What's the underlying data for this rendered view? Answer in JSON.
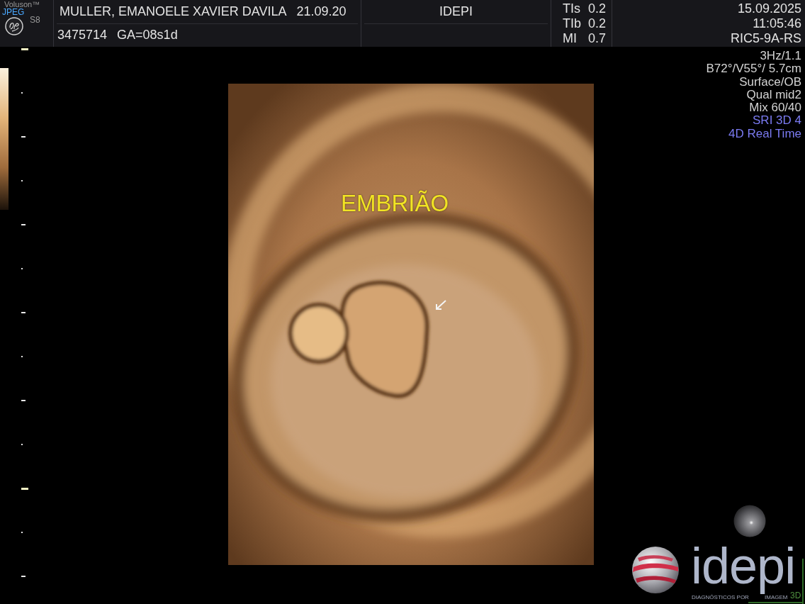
{
  "header": {
    "system": {
      "brand": "Voluson™",
      "format": "JPEG",
      "model": "S8"
    },
    "patient": {
      "name": "MULLER, EMANOELE XAVIER DAVILA",
      "birth_date": "21.09.20",
      "id": "3475714",
      "gestational_age": "GA=08s1d"
    },
    "institution": "IDEPI",
    "indices": [
      {
        "label": "TIs",
        "value": "0.2"
      },
      {
        "label": "TIb",
        "value": "0.2"
      },
      {
        "label": "MI",
        "value": "0.7"
      }
    ],
    "date": "15.09.2025",
    "time": "11:05:46",
    "probe": "RIC5-9A-RS"
  },
  "parameters": [
    {
      "text": "3Hz/1.1",
      "color": "#d4d4d4"
    },
    {
      "text": "B72°/V55°/ 5.7cm",
      "color": "#d4d4d4"
    },
    {
      "text": "Surface/OB",
      "color": "#d4d4d4"
    },
    {
      "text": "Qual mid2",
      "color": "#d4d4d4"
    },
    {
      "text": "Mix 60/40",
      "color": "#d4d4d4"
    },
    {
      "text": "SRI 3D 4",
      "color": "#7b7bf2"
    },
    {
      "text": "4D Real Time",
      "color": "#7b7bf2"
    }
  ],
  "annotation": {
    "text": "EMBRIÃO"
  },
  "logo": {
    "wordmark": "idepi",
    "tagline": "DIAGNÓSTICOS POR",
    "tagline_end": "IMAGEM",
    "badge": "3D"
  }
}
